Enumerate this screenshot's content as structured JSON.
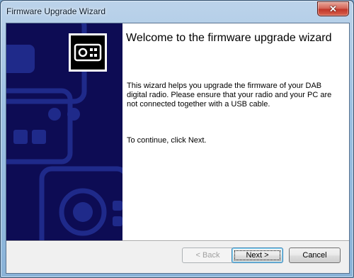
{
  "window": {
    "title": "Firmware Upgrade Wizard"
  },
  "titlebar": {
    "close_glyph": "✕"
  },
  "wizard": {
    "heading": "Welcome to the firmware upgrade wizard",
    "intro": "This wizard helps you upgrade the firmware of your DAB digital radio. Please ensure that your radio and your PC are not connected together with a USB cable.",
    "continue_hint": "To continue, click Next."
  },
  "buttons": {
    "back": {
      "label": "< Back",
      "enabled": false
    },
    "next": {
      "label": "Next >",
      "enabled": true,
      "default": true
    },
    "cancel": {
      "label": "Cancel",
      "enabled": true
    }
  },
  "icons": {
    "badge": "radio-icon",
    "panel": "radio-pattern"
  },
  "colors": {
    "side_panel": "#0d0c54",
    "panel_pattern": "#1f2a8a",
    "close_button": "#c1372a",
    "default_button_border": "#3c7fb1"
  }
}
